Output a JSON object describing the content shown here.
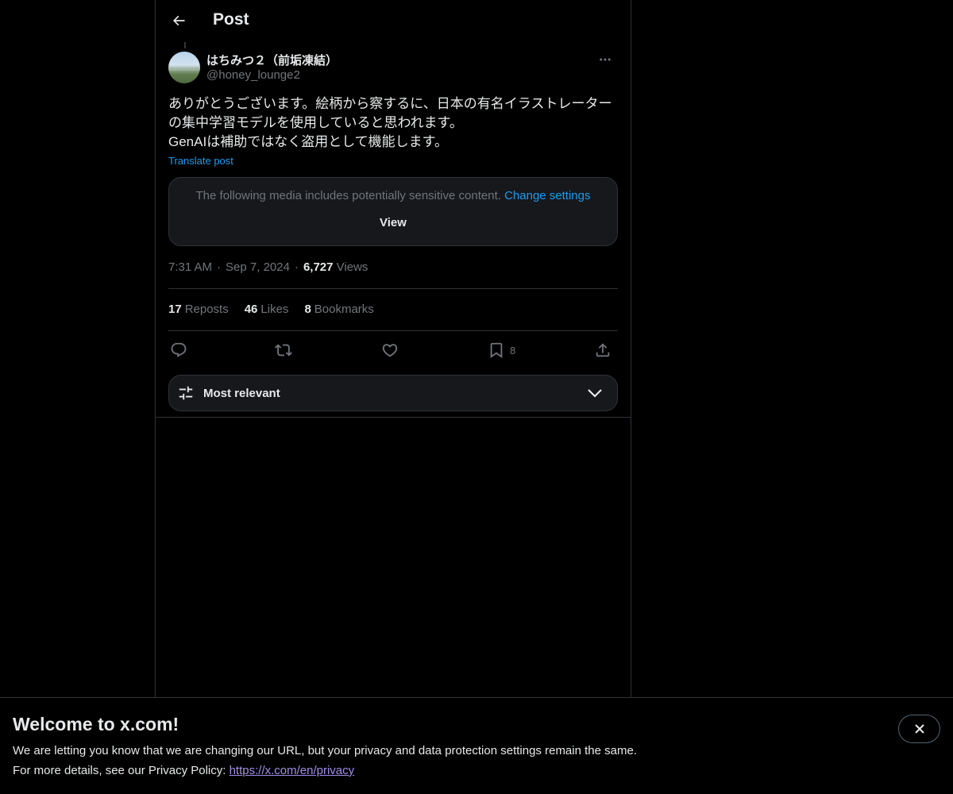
{
  "header": {
    "title": "Post"
  },
  "post": {
    "author": {
      "display_name": "はちみつ２（前垢凍結）",
      "handle": "@honey_lounge2"
    },
    "text_lines": [
      "ありがとうございます。絵柄から察するに、日本の有名イラストレーター",
      "の集中学習モデルを使用していると思われます。",
      "GenAIは補助ではなく盗用として機能します。"
    ],
    "translate_label": "Translate post",
    "sensitive": {
      "message": "The following media includes potentially sensitive content.",
      "change_settings": "Change settings",
      "view_label": "View"
    },
    "meta": {
      "time": "7:31 AM",
      "date": "Sep 7, 2024",
      "views_count": "6,727",
      "views_label": "Views"
    },
    "stats": {
      "reposts_count": "17",
      "reposts_label": "Reposts",
      "likes_count": "46",
      "likes_label": "Likes",
      "bookmarks_count": "8",
      "bookmarks_label": "Bookmarks"
    },
    "actions": {
      "reply_icon": "reply-icon",
      "repost_icon": "repost-icon",
      "like_icon": "heart-icon",
      "bookmark_icon": "bookmark-icon",
      "bookmark_count": "8",
      "share_icon": "share-icon"
    }
  },
  "sort": {
    "label": "Most relevant"
  },
  "banner": {
    "title": "Welcome to x.com!",
    "line1": "We are letting you know that we are changing our URL, but your privacy and data protection settings remain the same.",
    "line2_prefix": "For more details, see our Privacy Policy: ",
    "link": "https://x.com/en/privacy"
  },
  "colors": {
    "background": "#000000",
    "accent": "#1d9bf0",
    "text_primary": "#e7e9ea",
    "text_secondary": "#71767b",
    "border": "#2f3336",
    "link_visited": "#a08fe6"
  }
}
